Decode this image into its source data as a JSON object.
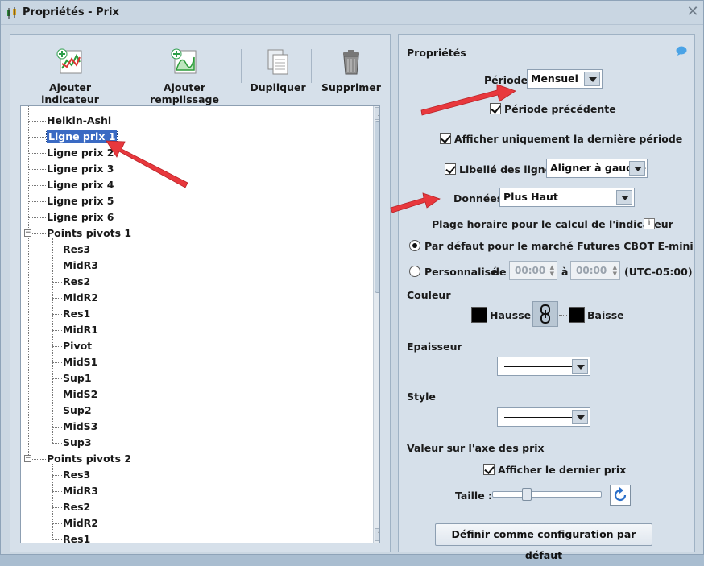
{
  "window": {
    "title": "Propriétés - Prix"
  },
  "toolbar": {
    "add_indicator": "Ajouter indicateur",
    "add_fill": "Ajouter remplissage",
    "duplicate": "Dupliquer",
    "delete": "Supprimer"
  },
  "tree": {
    "top_items": [
      "Heikin-Ashi",
      "Ligne prix 1",
      "Ligne prix 2",
      "Ligne prix 3",
      "Ligne prix 4",
      "Ligne prix 5",
      "Ligne prix 6"
    ],
    "pivot1_label": "Points pivots 1",
    "pivot1_children": [
      "Res3",
      "MidR3",
      "Res2",
      "MidR2",
      "Res1",
      "MidR1",
      "Pivot",
      "MidS1",
      "Sup1",
      "MidS2",
      "Sup2",
      "MidS3",
      "Sup3"
    ],
    "pivot2_label": "Points pivots 2",
    "pivot2_children": [
      "Res3",
      "MidR3",
      "Res2",
      "MidR2",
      "Res1"
    ],
    "selected": "Ligne prix 1"
  },
  "props": {
    "header": "Propriétés",
    "period_label": "Période",
    "period_value": "Mensuel",
    "prev_period": "Période précédente",
    "last_period_only": "Afficher uniquement la dernière période",
    "line_labels": "Libellé des lignes",
    "line_labels_value": "Aligner à gauche",
    "data_label": "Données",
    "data_value": "Plus Haut",
    "time_range": "Plage horaire pour le calcul de l'indicateur",
    "default_market": "Par défaut pour le marché Futures CBOT E-mini",
    "custom": "Personnalisé",
    "from": "de",
    "to": "à",
    "time_from": "00:00",
    "time_to": "00:00",
    "timezone": "(UTC-05:00)",
    "color": "Couleur",
    "up": "Hausse",
    "down": "Baisse",
    "thickness": "Epaisseur",
    "style": "Style",
    "axis_value": "Valeur sur l'axe des prix",
    "show_last_price": "Afficher le dernier prix",
    "size": "Taille :",
    "set_default": "Définir comme configuration par défaut",
    "slider_value": 0.3
  },
  "colors": {
    "selection": "#3a6ac3",
    "arrow": "#e8383d",
    "swatch_up": "#000000",
    "swatch_down": "#000000"
  }
}
